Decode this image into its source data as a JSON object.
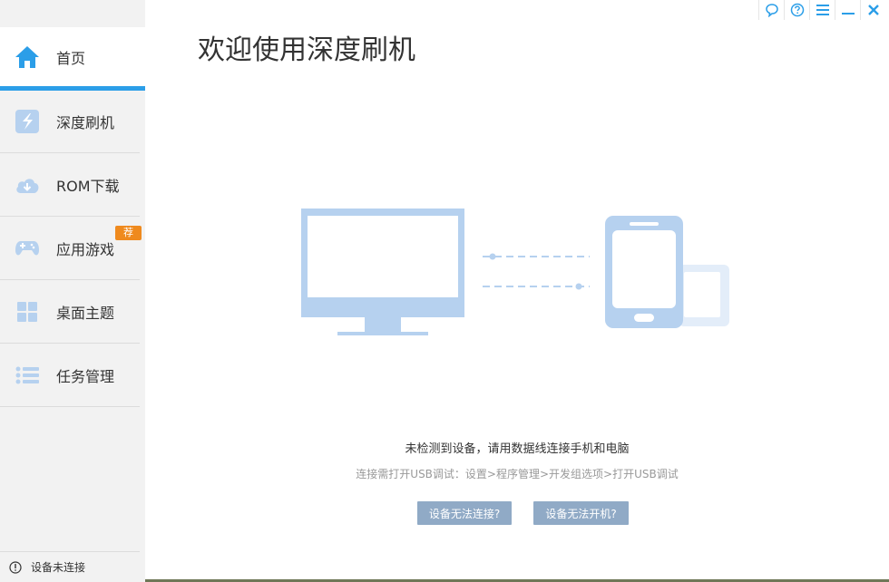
{
  "sidebar": {
    "items": [
      {
        "label": "首页"
      },
      {
        "label": "深度刷机"
      },
      {
        "label": "ROM下载"
      },
      {
        "label": "应用游戏",
        "badge": "荐"
      },
      {
        "label": "桌面主题"
      },
      {
        "label": "任务管理"
      }
    ],
    "status": "设备未连接"
  },
  "main": {
    "title": "欢迎使用深度刷机",
    "message": "未检测到设备，请用数据线连接手机和电脑",
    "hint": "连接需打开USB调试：设置>程序管理>开发组选项>打开USB调试",
    "buttons": {
      "cannot_connect": "设备无法连接?",
      "cannot_boot": "设备无法开机?"
    }
  },
  "colors": {
    "accent": "#2b9ee8",
    "icon_blue": "#b6d1ef",
    "button": "#90aac6",
    "badge": "#ef8a1e"
  },
  "icons": {
    "window": [
      "feedback-icon",
      "help-icon",
      "menu-icon",
      "minimize-icon",
      "close-icon"
    ]
  }
}
